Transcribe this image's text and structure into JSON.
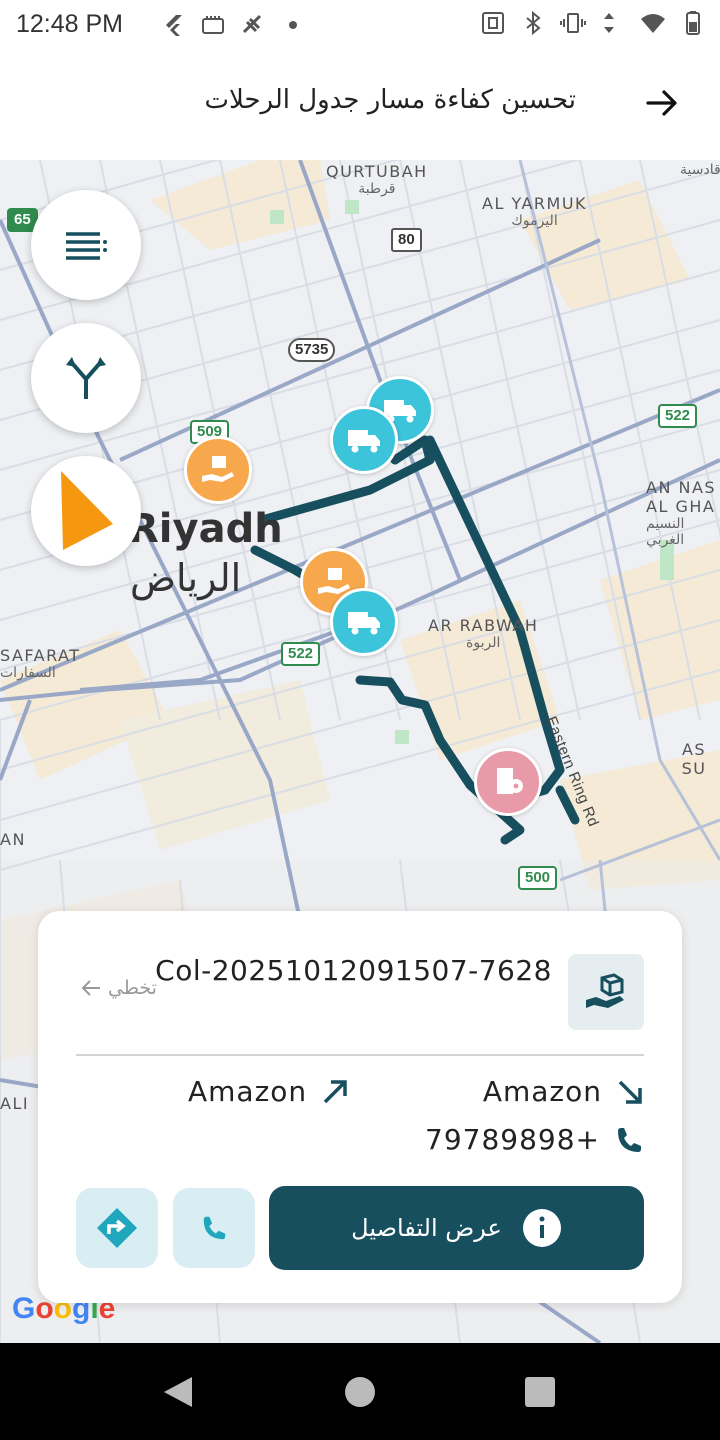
{
  "status_bar": {
    "time": "12:48 PM",
    "icons": [
      "flutter-icon",
      "sim-card-icon",
      "satellite-icon",
      "dot-icon",
      "nfc-icon",
      "bluetooth-icon",
      "vibrate-icon",
      "data-arrows-icon",
      "wifi-icon",
      "battery-icon"
    ]
  },
  "header": {
    "title": "تحسين كفاءة مسار جدول الرحلات",
    "back_icon": "arrow-right-icon"
  },
  "map": {
    "labels": {
      "qurtubah": "QURTUBAH",
      "qurtubah_ar": "قرطبة",
      "al_yarmuk": "AL YARMUK",
      "al_yarmuk_ar": "اليرموك",
      "an_nasim": "AN NAS",
      "al_gharbi": "AL GHA",
      "an_nasim_ar": "النسيم",
      "al_gharbi_ar": "الغربي",
      "ar_rabwah": "AR RABWAH",
      "ar_rabwah_ar": "الربوة",
      "as_su": "AS SU",
      "safarat": "SAFARAT",
      "safarat_ar": "السفارات",
      "an": "AN",
      "ali": "ALI",
      "top_right_ar": "قادسية",
      "city": "Riyadh",
      "city_ar": "الرياض",
      "road": "Eastern Ring Rd"
    },
    "shields": {
      "s80": "80",
      "s5735": "5735",
      "s509": "509",
      "s522a": "522",
      "s522b": "522",
      "s500": "500",
      "s65": "65"
    },
    "google": "Google"
  },
  "colors": {
    "route": "#174f5e",
    "truck": "#3cc4da",
    "pickup": "#f7a74c",
    "destination": "#e99aa8",
    "accent": "#174f5e",
    "nav_arrow": "#f5970f"
  },
  "card": {
    "order_id": "Col-20251012091507-7628",
    "skip_label": "تخطي",
    "from_name": "Amazon",
    "to_name": "Amazon",
    "phone": "79789898+",
    "details_button": "عرض التفاصيل"
  }
}
